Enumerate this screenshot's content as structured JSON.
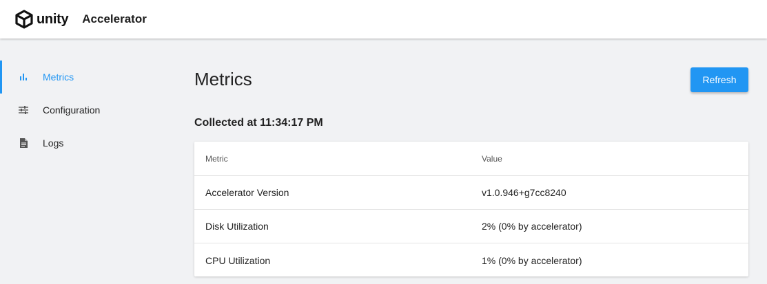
{
  "header": {
    "logo_text": "unity",
    "app_title": "Accelerator"
  },
  "sidebar": {
    "items": [
      {
        "label": "Metrics",
        "icon": "bar-chart-icon",
        "active": true
      },
      {
        "label": "Configuration",
        "icon": "sliders-icon",
        "active": false
      },
      {
        "label": "Logs",
        "icon": "document-icon",
        "active": false
      }
    ]
  },
  "main": {
    "title": "Metrics",
    "refresh_label": "Refresh",
    "collected_text": "Collected at 11:34:17 PM",
    "table": {
      "columns": [
        "Metric",
        "Value"
      ],
      "rows": [
        [
          "Accelerator Version",
          "v1.0.946+g7cc8240"
        ],
        [
          "Disk Utilization",
          "2% (0% by accelerator)"
        ],
        [
          "CPU Utilization",
          "1% (0% by accelerator)"
        ]
      ]
    }
  },
  "colors": {
    "accent": "#2196f3",
    "background": "#f1f2f4",
    "surface": "#ffffff"
  }
}
